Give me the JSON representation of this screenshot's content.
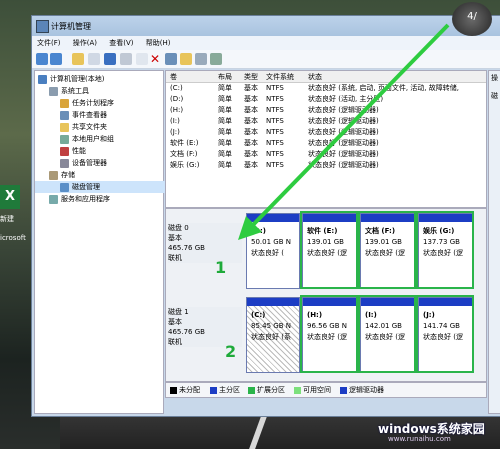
{
  "window": {
    "title": "计算机管理",
    "clock_text": "4/"
  },
  "menubar": [
    "文件(F)",
    "操作(A)",
    "查看(V)",
    "帮助(H)"
  ],
  "tree": [
    {
      "label": "计算机管理(本地)",
      "indent": 0
    },
    {
      "label": "系统工具",
      "indent": 1
    },
    {
      "label": "任务计划程序",
      "indent": 2
    },
    {
      "label": "事件查看器",
      "indent": 2
    },
    {
      "label": "共享文件夹",
      "indent": 2
    },
    {
      "label": "本地用户和组",
      "indent": 2
    },
    {
      "label": "性能",
      "indent": 2
    },
    {
      "label": "设备管理器",
      "indent": 2
    },
    {
      "label": "存储",
      "indent": 1
    },
    {
      "label": "磁盘管理",
      "indent": 2,
      "selected": true
    },
    {
      "label": "服务和应用程序",
      "indent": 1
    }
  ],
  "list": {
    "headers": [
      "卷",
      "布局",
      "类型",
      "文件系统",
      "状态"
    ],
    "rows": [
      [
        "(C:)",
        "简单",
        "基本",
        "NTFS",
        "状态良好 (系统, 启动, 页面文件, 活动, 故障转储,"
      ],
      [
        "(D:)",
        "简单",
        "基本",
        "NTFS",
        "状态良好 (活动, 主分区)"
      ],
      [
        "(H:)",
        "简单",
        "基本",
        "NTFS",
        "状态良好 (逻辑驱动器)"
      ],
      [
        "(I:)",
        "简单",
        "基本",
        "NTFS",
        "状态良好 (逻辑驱动器)"
      ],
      [
        "(J:)",
        "简单",
        "基本",
        "NTFS",
        "状态良好 (逻辑驱动器)"
      ],
      [
        "软件 (E:)",
        "简单",
        "基本",
        "NTFS",
        "状态良好 (逻辑驱动器)"
      ],
      [
        "文档 (F:)",
        "简单",
        "基本",
        "NTFS",
        "状态良好 (逻辑驱动器)"
      ],
      [
        "娱乐 (G:)",
        "简单",
        "基本",
        "NTFS",
        "状态良好 (逻辑驱动器)"
      ]
    ]
  },
  "right_pane": {
    "title": "操",
    "item": "磁"
  },
  "disks": [
    {
      "name": "磁盘 0",
      "type": "基本",
      "size": "465.76 GB",
      "status": "联机",
      "partitions": [
        {
          "label": "(D:)",
          "size": "50.01 GB N",
          "status": "状态良好 (",
          "hatched": false
        },
        {
          "label": "软件 (E:)",
          "size": "139.01 GB",
          "status": "状态良好 (逻",
          "hatched": false
        },
        {
          "label": "文档 (F:)",
          "size": "139.01 GB",
          "status": "状态良好 (逻",
          "hatched": false
        },
        {
          "label": "娱乐 (G:)",
          "size": "137.73 GB",
          "status": "状态良好 (逻",
          "hatched": false
        }
      ]
    },
    {
      "name": "磁盘 1",
      "type": "基本",
      "size": "465.76 GB",
      "status": "联机",
      "partitions": [
        {
          "label": "(C:)",
          "size": "85.45 GB N",
          "status": "状态良好 (系",
          "hatched": true
        },
        {
          "label": "(H:)",
          "size": "96.56 GB N",
          "status": "状态良好 (逻",
          "hatched": false
        },
        {
          "label": "(I:)",
          "size": "142.01 GB",
          "status": "状态良好 (逻",
          "hatched": false
        },
        {
          "label": "(J:)",
          "size": "141.74 GB",
          "status": "状态良好 (逻",
          "hatched": false
        }
      ]
    }
  ],
  "annotations": [
    "1",
    "2"
  ],
  "legend": [
    {
      "label": "未分配",
      "color": "#000000"
    },
    {
      "label": "主分区",
      "color": "#1c3dc4"
    },
    {
      "label": "扩展分区",
      "color": "#2ab44a"
    },
    {
      "label": "可用空间",
      "color": "#7ce07c"
    },
    {
      "label": "逻辑驱动器",
      "color": "#1c3dc4"
    }
  ],
  "desktop": {
    "icon_text": "X",
    "icon_label": "新建",
    "icon_label2": "icrosoft"
  },
  "watermark": {
    "main": "windows系统家园",
    "sub": "www.runaihu.com"
  }
}
